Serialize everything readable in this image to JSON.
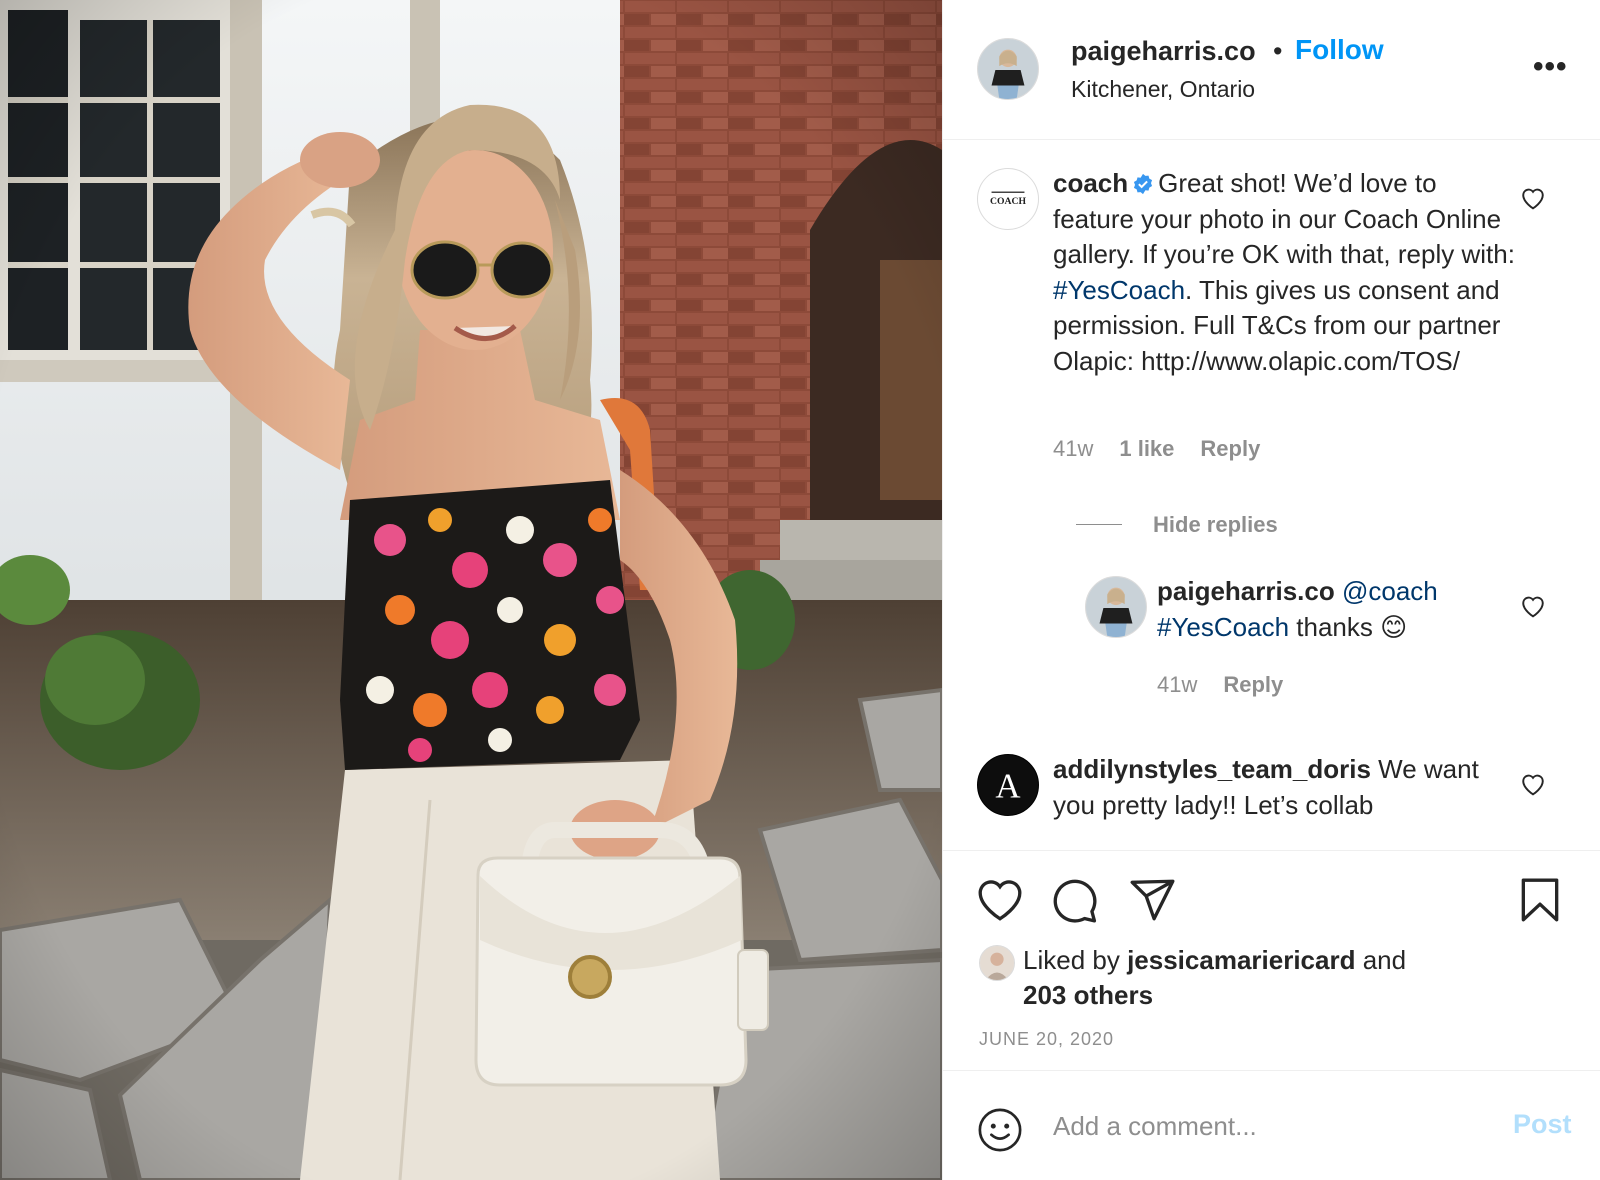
{
  "post": {
    "username": "paigeharris.co",
    "separator": "•",
    "follow_label": "Follow",
    "location": "Kitchener, Ontario",
    "more_label": "•••"
  },
  "comments": [
    {
      "username": "coach",
      "verified": true,
      "text_before": "Great shot! We’d love to feature your photo in our Coach Online gallery. If you’re OK with that, reply with: ",
      "hashtag": "#YesCoach",
      "text_after": ". This gives us consent and permission. Full T&Cs from our partner Olapic: http://www.olapic.com/TOS/",
      "time": "41w",
      "likes": "1 like",
      "reply_label": "Reply",
      "avatar": "coach-logo",
      "avatar_text": "COACH",
      "hide_replies_label": "Hide replies",
      "replies": [
        {
          "username": "paigeharris.co",
          "mention": "@coach",
          "hashtag": "#YesCoach",
          "text": " thanks",
          "emoji": "😊",
          "time": "41w",
          "reply_label": "Reply"
        }
      ]
    },
    {
      "username": "addilynstyles_team_doris",
      "text": " We want you pretty lady!! Let’s collab",
      "avatar": "addilyn-logo",
      "avatar_text": "A"
    }
  ],
  "actions": {
    "like_icon": "heart-icon",
    "comment_icon": "comment-bubble-icon",
    "share_icon": "paper-plane-icon",
    "save_icon": "bookmark-icon"
  },
  "likes": {
    "prefix": "Liked by ",
    "user": "jessicamariericard",
    "middle": " and",
    "others": "203 others"
  },
  "date": "JUNE 20, 2020",
  "add_comment": {
    "placeholder": "Add a comment...",
    "post_label": "Post",
    "emoji_icon": "smiley-icon"
  },
  "colors": {
    "accent": "#0095f6",
    "hashtag": "#00376b",
    "muted": "#8e8e8e",
    "post_disabled": "#b2dffc"
  }
}
